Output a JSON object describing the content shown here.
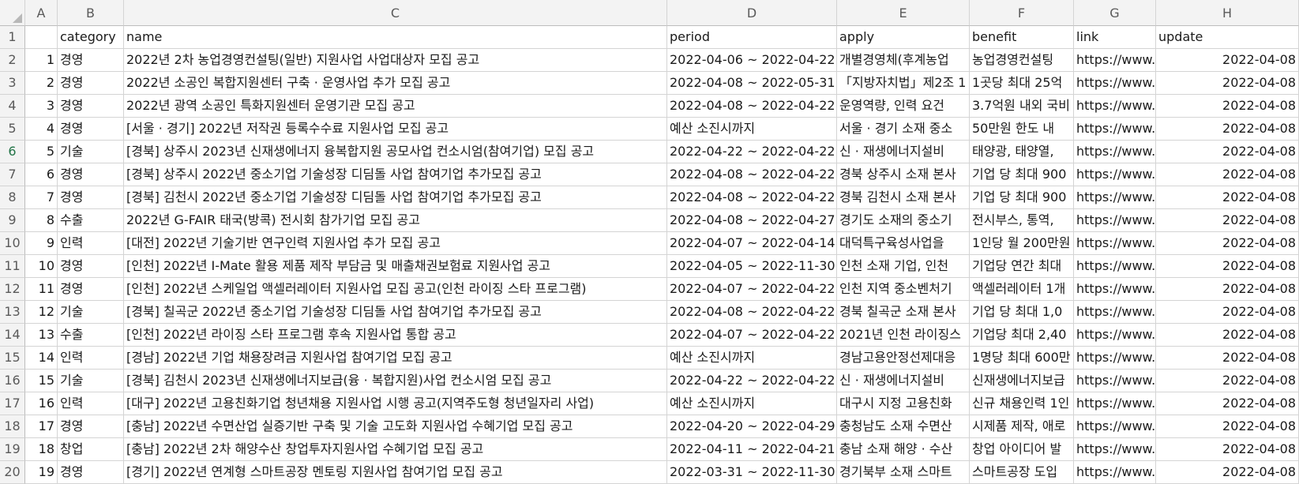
{
  "column_letters": [
    "A",
    "B",
    "C",
    "D",
    "E",
    "F",
    "G",
    "H"
  ],
  "header_row": {
    "row_number": "1",
    "cells": [
      "",
      "category",
      "name",
      "period",
      "apply",
      "benefit",
      "link",
      "update"
    ]
  },
  "rows": [
    {
      "row_number": "2",
      "cells": [
        "1",
        "경영",
        "2022년 2차 농업경영컨설팅(일반) 지원사업 사업대상자 모집 공고",
        "2022-04-06 ~ 2022-04-22",
        "개별경영체(후계농업",
        "농업경영컨설팅",
        "https://www.",
        "2022-04-08"
      ]
    },
    {
      "row_number": "3",
      "cells": [
        "2",
        "경영",
        "2022년 소공인 복합지원센터 구축 · 운영사업 추가 모집 공고",
        "2022-04-08 ~ 2022-05-31",
        "「지방자치법」제2조 1",
        "1곳당 최대 25억",
        "https://www.",
        "2022-04-08"
      ]
    },
    {
      "row_number": "4",
      "cells": [
        "3",
        "경영",
        "2022년 광역 소공인 특화지원센터 운영기관 모집 공고",
        "2022-04-08 ~ 2022-04-22",
        "운영역량, 인력 요건",
        "3.7억원 내외 국비",
        "https://www.",
        "2022-04-08"
      ]
    },
    {
      "row_number": "5",
      "cells": [
        "4",
        "경영",
        "[서울 · 경기] 2022년 저작권 등록수수료 지원사업 모집 공고",
        "예산 소진시까지",
        "서울 · 경기 소재 중소",
        "50만원 한도 내",
        "https://www.",
        "2022-04-08"
      ]
    },
    {
      "row_number": "6",
      "cells": [
        "5",
        "기술",
        "[경북] 상주시 2023년 신재생에너지 융복합지원 공모사업 컨소시엄(참여기업) 모집 공고",
        "2022-04-22 ~ 2022-04-22",
        "신 · 재생에너지설비",
        "태양광, 태양열,",
        "https://www.",
        "2022-04-08"
      ]
    },
    {
      "row_number": "7",
      "cells": [
        "6",
        "경영",
        "[경북] 상주시 2022년 중소기업 기술성장 디딤돌 사업 참여기업 추가모집 공고",
        "2022-04-08 ~ 2022-04-22",
        "경북 상주시 소재 본사",
        "기업 당 최대 900",
        "https://www.",
        "2022-04-08"
      ]
    },
    {
      "row_number": "8",
      "cells": [
        "7",
        "경영",
        "[경북] 김천시 2022년 중소기업 기술성장 디딤돌 사업 참여기업 추가모집 공고",
        "2022-04-08 ~ 2022-04-22",
        "경북 김천시 소재 본사",
        "기업 당 최대 900",
        "https://www.",
        "2022-04-08"
      ]
    },
    {
      "row_number": "9",
      "cells": [
        "8",
        "수출",
        "2022년 G-FAIR 태국(방콕) 전시회 참가기업 모집 공고",
        "2022-04-08 ~ 2022-04-27",
        "경기도 소재의 중소기",
        "전시부스, 통역,",
        "https://www.",
        "2022-04-08"
      ]
    },
    {
      "row_number": "10",
      "cells": [
        "9",
        "인력",
        "[대전] 2022년 기술기반 연구인력 지원사업 추가 모집 공고",
        "2022-04-07 ~ 2022-04-14",
        "대덕특구육성사업을",
        "1인당 월 200만원",
        "https://www.",
        "2022-04-08"
      ]
    },
    {
      "row_number": "11",
      "cells": [
        "10",
        "경영",
        "[인천] 2022년 I-Mate 활용 제품 제작 부담금 및 매출채권보험료 지원사업 공고",
        "2022-04-05 ~ 2022-11-30",
        "인천 소재 기업, 인천",
        "기업당 연간 최대",
        "https://www.",
        "2022-04-08"
      ]
    },
    {
      "row_number": "12",
      "cells": [
        "11",
        "경영",
        "[인천] 2022년 스케일업 액셀러레이터 지원사업 모집 공고(인천 라이징 스타 프로그램)",
        "2022-04-07 ~ 2022-04-22",
        "인천 지역 중소벤처기",
        "액셀러레이터 1개",
        "https://www.",
        "2022-04-08"
      ]
    },
    {
      "row_number": "13",
      "cells": [
        "12",
        "기술",
        "[경북] 칠곡군 2022년 중소기업 기술성장 디딤돌 사업 참여기업 추가모집 공고",
        "2022-04-08 ~ 2022-04-22",
        "경북 칠곡군 소재 본사",
        "기업 당 최대 1,0",
        "https://www.",
        "2022-04-08"
      ]
    },
    {
      "row_number": "14",
      "cells": [
        "13",
        "수출",
        "[인천] 2022년 라이징 스타 프로그램 후속 지원사업 통합 공고",
        "2022-04-07 ~ 2022-04-22",
        "2021년 인천 라이징스",
        "기업당 최대 2,40",
        "https://www.",
        "2022-04-08"
      ]
    },
    {
      "row_number": "15",
      "cells": [
        "14",
        "인력",
        "[경남] 2022년 기업 채용장려금 지원사업 참여기업 모집 공고",
        "예산 소진시까지",
        "경남고용안정선제대응",
        "1명당 최대 600만",
        "https://www.",
        "2022-04-08"
      ]
    },
    {
      "row_number": "16",
      "cells": [
        "15",
        "기술",
        "[경북] 김천시 2023년 신재생에너지보급(융 · 복합지원)사업 컨소시엄 모집 공고",
        "2022-04-22 ~ 2022-04-22",
        "신 · 재생에너지설비",
        "신재생에너지보급",
        "https://www.",
        "2022-04-08"
      ]
    },
    {
      "row_number": "17",
      "cells": [
        "16",
        "인력",
        "[대구] 2022년 고용친화기업 청년채용 지원사업 시행 공고(지역주도형 청년일자리 사업)",
        "예산 소진시까지",
        "대구시 지정 고용친화",
        "신규 채용인력 1인",
        "https://www.",
        "2022-04-08"
      ]
    },
    {
      "row_number": "18",
      "cells": [
        "17",
        "경영",
        "[충남] 2022년 수면산업 실증기반 구축 및 기술 고도화 지원사업 수혜기업 모집 공고",
        "2022-04-20 ~ 2022-04-29",
        "충청남도 소재 수면산",
        "시제품 제작, 애로",
        "https://www.",
        "2022-04-08"
      ]
    },
    {
      "row_number": "19",
      "cells": [
        "18",
        "창업",
        "[충남] 2022년 2차 해양수산 창업투자지원사업 수혜기업 모집 공고",
        "2022-04-11 ~ 2022-04-21",
        "충남 소재 해양 · 수산",
        "창업 아이디어 발",
        "https://www.",
        "2022-04-08"
      ]
    },
    {
      "row_number": "20",
      "cells": [
        "19",
        "경영",
        "[경기] 2022년 연계형 스마트공장 멘토링 지원사업 참여기업 모집 공고",
        "2022-03-31 ~ 2022-11-30",
        "경기북부 소재 스마트",
        "스마트공장 도입",
        "https://www.",
        "2022-04-08"
      ]
    }
  ],
  "selected_row": "6"
}
